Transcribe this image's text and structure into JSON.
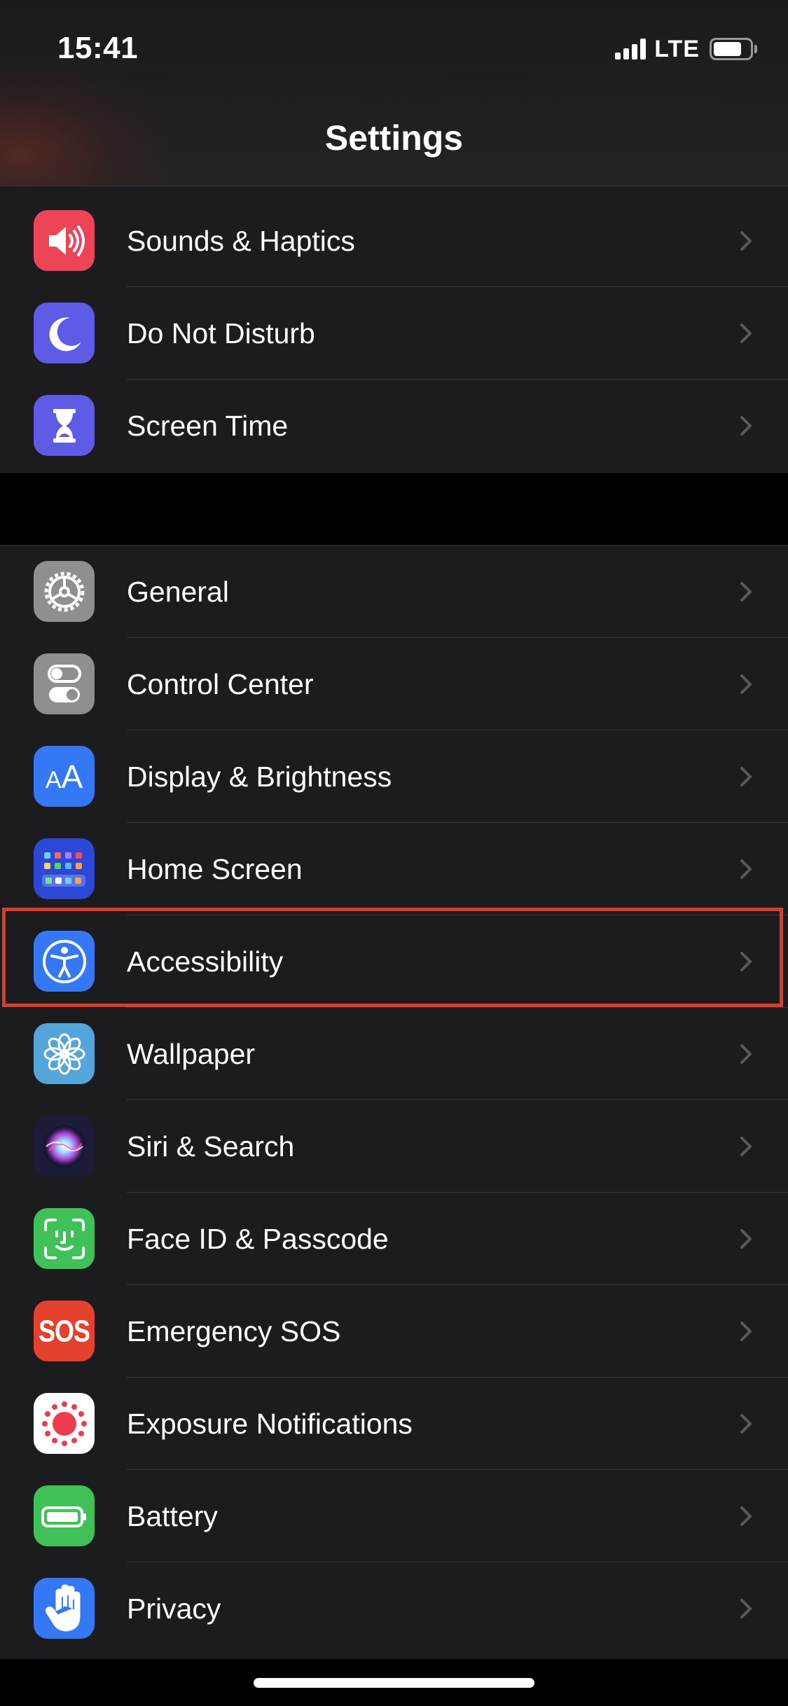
{
  "status_bar": {
    "time": "15:41",
    "network": "LTE",
    "battery_level": 0.78,
    "signal_bars": 4
  },
  "nav": {
    "title": "Settings"
  },
  "groups": {
    "top": [
      {
        "label": "Sounds & Haptics",
        "icon": "speaker-icon",
        "color": "#ee4458"
      },
      {
        "label": "Do Not Disturb",
        "icon": "moon-icon",
        "color": "#5e5ce6"
      },
      {
        "label": "Screen Time",
        "icon": "hourglass-icon",
        "color": "#5e5ce6"
      }
    ],
    "main": [
      {
        "label": "General",
        "icon": "gear-icon",
        "color": "#8e8e93"
      },
      {
        "label": "Control Center",
        "icon": "toggles-icon",
        "color": "#8e8e93"
      },
      {
        "label": "Display & Brightness",
        "icon": "text-size-icon",
        "color": "#3478f6"
      },
      {
        "label": "Home Screen",
        "icon": "app-grid-icon",
        "color": "#2b48d6"
      },
      {
        "label": "Accessibility",
        "icon": "accessibility-icon",
        "color": "#3478f6"
      },
      {
        "label": "Wallpaper",
        "icon": "flower-icon",
        "color": "#54a5d9"
      },
      {
        "label": "Siri & Search",
        "icon": "siri-icon",
        "color": "#1c1c3a"
      },
      {
        "label": "Face ID & Passcode",
        "icon": "face-id-icon",
        "color": "#3fc158"
      },
      {
        "label": "Emergency SOS",
        "icon": "sos-icon",
        "icon_text": "SOS",
        "color": "#e5412f"
      },
      {
        "label": "Exposure Notifications",
        "icon": "exposure-icon",
        "color": "#ffffff"
      },
      {
        "label": "Battery",
        "icon": "battery-icon",
        "color": "#3fc158"
      },
      {
        "label": "Privacy",
        "icon": "hand-icon",
        "color": "#3478f6"
      }
    ]
  },
  "icons": {
    "display_text": "AA"
  },
  "highlight": {
    "target": "Accessibility",
    "color": "#e03c23"
  }
}
